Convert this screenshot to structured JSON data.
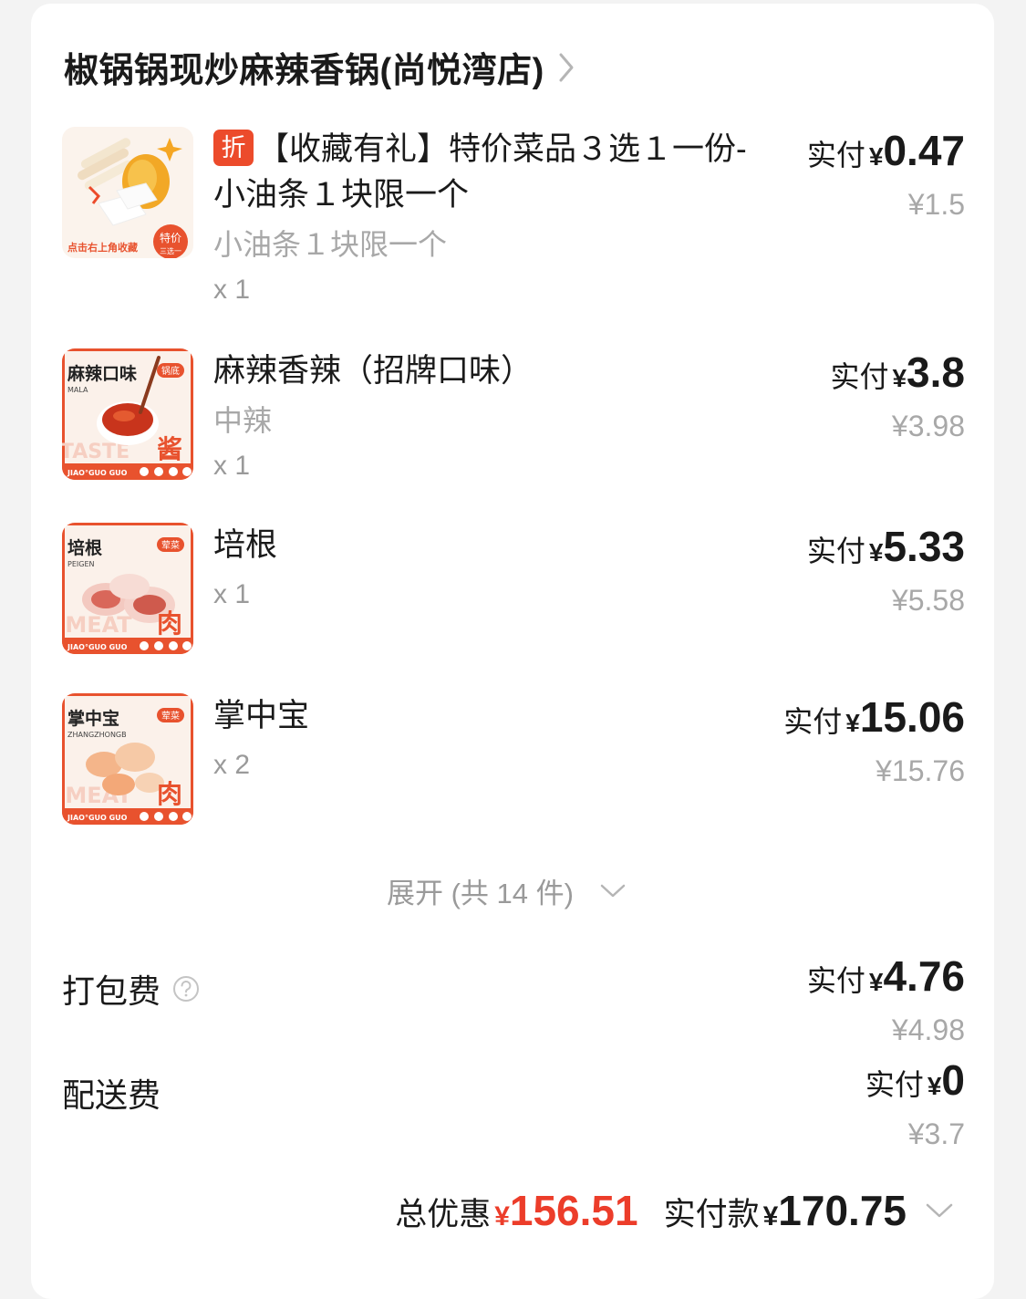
{
  "store": {
    "name": "椒锅锅现炒麻辣香锅(尚悦湾店)"
  },
  "items": [
    {
      "promo_tag": "折",
      "title": "【收藏有礼】特价菜品３选１一份-小油条１块限一个",
      "spec": "小油条１块限一个",
      "qty": "x 1",
      "paid_label": "实付",
      "currency": "¥",
      "paid": "0.47",
      "original": "¥1.5",
      "thumb_text": {
        "caption": "点击右上角收藏",
        "badge_top": "特价",
        "badge_bottom": "三选一"
      }
    },
    {
      "title": "麻辣香辣（招牌口味）",
      "spec": "中辣",
      "qty": "x 1",
      "paid_label": "实付",
      "currency": "¥",
      "paid": "3.8",
      "original": "¥3.98",
      "thumb_text": {
        "title": "麻辣口味",
        "sub": "MALA",
        "corner": "锅底",
        "big": "酱",
        "ghost": "TASTE",
        "footer": "JIAO°GUO GUO"
      }
    },
    {
      "title": "培根",
      "qty": "x 1",
      "paid_label": "实付",
      "currency": "¥",
      "paid": "5.33",
      "original": "¥5.58",
      "thumb_text": {
        "title": "培根",
        "sub": "PEIGEN",
        "corner": "荤菜",
        "big": "肉",
        "ghost": "MEAT",
        "footer": "JIAO°GUO GUO"
      }
    },
    {
      "title": "掌中宝",
      "qty": "x 2",
      "paid_label": "实付",
      "currency": "¥",
      "paid": "15.06",
      "original": "¥15.76",
      "thumb_text": {
        "title": "掌中宝",
        "sub": "ZHANGZHONGB",
        "corner": "荤菜",
        "big": "肉",
        "ghost": "MEAT",
        "footer": "JIAO°GUO GUO"
      }
    }
  ],
  "expand": {
    "label": "展开 (共 14 件)"
  },
  "fees": [
    {
      "label": "打包费",
      "paid_label": "实付",
      "currency": "¥",
      "paid": "4.76",
      "original": "¥4.98"
    },
    {
      "label": "配送费",
      "paid_label": "实付",
      "currency": "¥",
      "paid": "0",
      "original": "¥3.7"
    }
  ],
  "summary": {
    "discount_label": "总优惠",
    "discount_currency": "¥",
    "discount": "156.51",
    "total_label": "实付款",
    "total_currency": "¥",
    "total": "170.75"
  },
  "colors": {
    "accent_red": "#ec3d2a",
    "muted_gray": "#a8a8a8",
    "brand_orange": "#e8522e"
  }
}
